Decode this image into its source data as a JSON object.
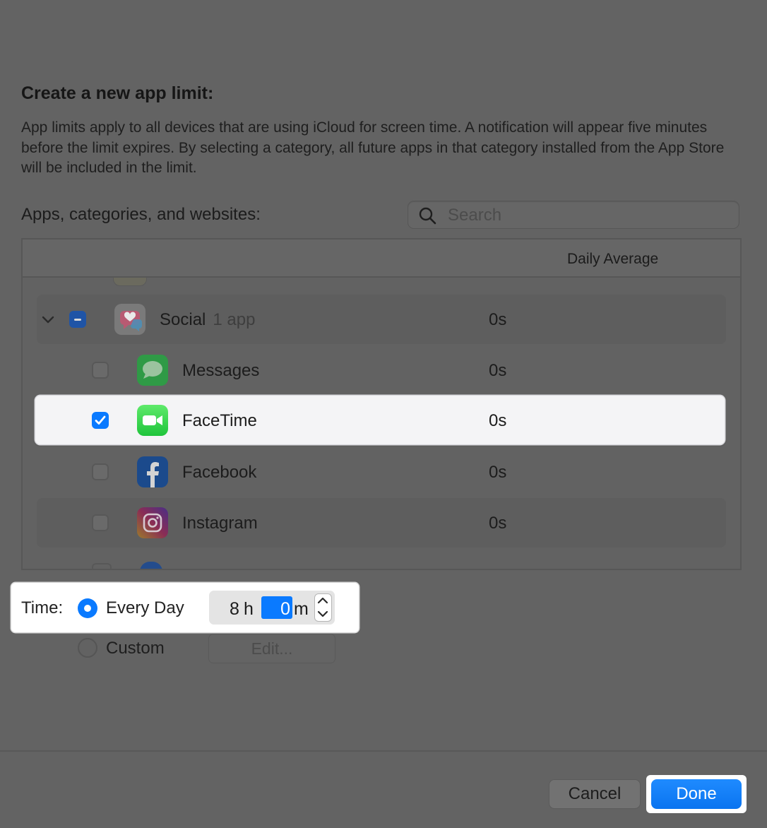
{
  "dialog": {
    "title": "Create a new app limit:",
    "description": "App limits apply to all devices that are using iCloud for screen time. A notification will appear five minutes before the limit expires. By selecting a category, all future apps in that category installed from the App Store will be included in the limit.",
    "list_label": "Apps, categories, and websites:"
  },
  "search": {
    "placeholder": "Search",
    "value": ""
  },
  "table": {
    "column_daily_average": "Daily Average",
    "category": {
      "name": "Social",
      "count": "1 app",
      "value": "0s",
      "state": "mixed"
    },
    "apps": [
      {
        "name": "Messages",
        "value": "0s",
        "checked": false,
        "icon": "messages-icon",
        "color": "#34c759"
      },
      {
        "name": "FaceTime",
        "value": "0s",
        "checked": true,
        "icon": "facetime-icon",
        "color": "#32d74b"
      },
      {
        "name": "Facebook",
        "value": "0s",
        "checked": false,
        "icon": "facebook-icon",
        "color": "#1877f2"
      },
      {
        "name": "Instagram",
        "value": "0s",
        "checked": false,
        "icon": "instagram-icon",
        "color": "#c13584"
      }
    ]
  },
  "time": {
    "label": "Time:",
    "every_day_label": "Every Day",
    "custom_label": "Custom",
    "selected": "every_day",
    "hours": "8",
    "hours_unit": "h",
    "minutes": "0",
    "minutes_unit": "m",
    "edit_label": "Edit..."
  },
  "buttons": {
    "cancel": "Cancel",
    "done": "Done"
  },
  "colors": {
    "accent": "#0a7aff",
    "dim_background": "#636363"
  }
}
